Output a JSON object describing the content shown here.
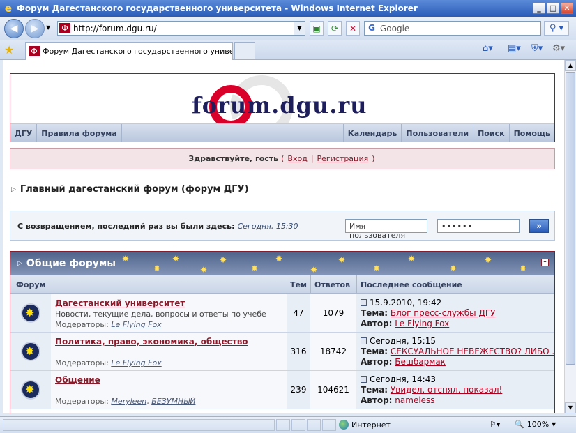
{
  "window": {
    "title": "Форум Дагестанского государственного университета - Windows Internet Explorer"
  },
  "address": {
    "url": "http://forum.dgu.ru/",
    "favicon": "Ф"
  },
  "search": {
    "placeholder": "Google"
  },
  "tab": {
    "title": "Форум Дагестанского государственного университе..."
  },
  "status": {
    "zone": "Интернет",
    "zoom": "100%"
  },
  "page": {
    "logo": "forum.dgu.ru",
    "nav_left": [
      "ДГУ",
      "Правила форума"
    ],
    "nav_right": [
      "Календарь",
      "Пользователи",
      "Поиск",
      "Помощь"
    ],
    "welcome": {
      "greeting": "Здравствуйте, гость",
      "open": "(",
      "login": "Вход",
      "sep": "|",
      "register": "Регистрация",
      "close": ")"
    },
    "crumb": "Главный дагестанский форум (форум ДГУ)",
    "login": {
      "text": "С возвращением, последний раз вы были здесь:",
      "time": "Сегодня, 15:30",
      "username": "Имя пользователя",
      "password": "••••••",
      "go": "»"
    },
    "category": {
      "title": "Общие форумы",
      "columns": {
        "forum": "Форум",
        "topics": "Тем",
        "replies": "Ответов",
        "last": "Последнее сообщение"
      },
      "rows": [
        {
          "title": "Дагестанский университет",
          "desc": "Новости, текущие дела, вопросы и ответы по учебе",
          "mods_label": "Модераторы:",
          "mods": "Le Flying Fox",
          "topics": "47",
          "replies": "1079",
          "date": "15.9.2010, 19:42",
          "topic_label": "Тема:",
          "topic": "Блог пресс-службы ДГУ",
          "author_label": "Автор:",
          "author": "Le Flying Fox"
        },
        {
          "title": "Политика, право, экономика, общество",
          "desc": "",
          "mods_label": "Модераторы:",
          "mods": "Le Flying Fox",
          "topics": "316",
          "replies": "18742",
          "date": "Сегодня, 15:15",
          "topic_label": "Тема:",
          "topic": "СЕКСУАЛЬНОЕ НЕВЕЖЕСТВО? ЛИБО ...",
          "author_label": "Автор:",
          "author": "Бешбармак"
        },
        {
          "title": "Общение",
          "desc": "",
          "mods_label": "Модераторы:",
          "mods": "Meryleen",
          "mods2": "БЕЗУМНЫЙ",
          "topics": "239",
          "replies": "104621",
          "date": "Сегодня, 14:43",
          "topic_label": "Тема:",
          "topic": "Увидел, отснял, показал!",
          "author_label": "Автор:",
          "author": "nameless"
        }
      ]
    }
  }
}
